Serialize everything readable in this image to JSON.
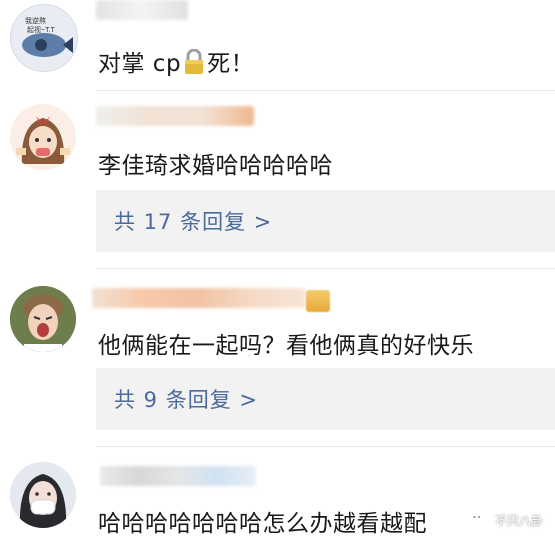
{
  "comments": [
    {
      "text_before": "对掌 cp",
      "lock_icon": "lock-icon",
      "text_after": "死！"
    },
    {
      "text": "李佳琦求婚哈哈哈哈哈",
      "replies_label": "共 17 条回复 >"
    },
    {
      "text": "他俩能在一起吗？看他俩真的好快乐",
      "replies_label": "共 9 条回复 >"
    },
    {
      "text": "哈哈哈哈哈哈哈怎么办越看越配"
    }
  ],
  "avatar_stamp": "我逆熬 \n 起视~T.T",
  "watermark": {
    "icon": "wechat-icon",
    "label": "不只八卦"
  },
  "colors": {
    "reply_link": "#4a6a9c",
    "reply_bg": "#f2f2f2",
    "text": "#1a1a1a"
  }
}
